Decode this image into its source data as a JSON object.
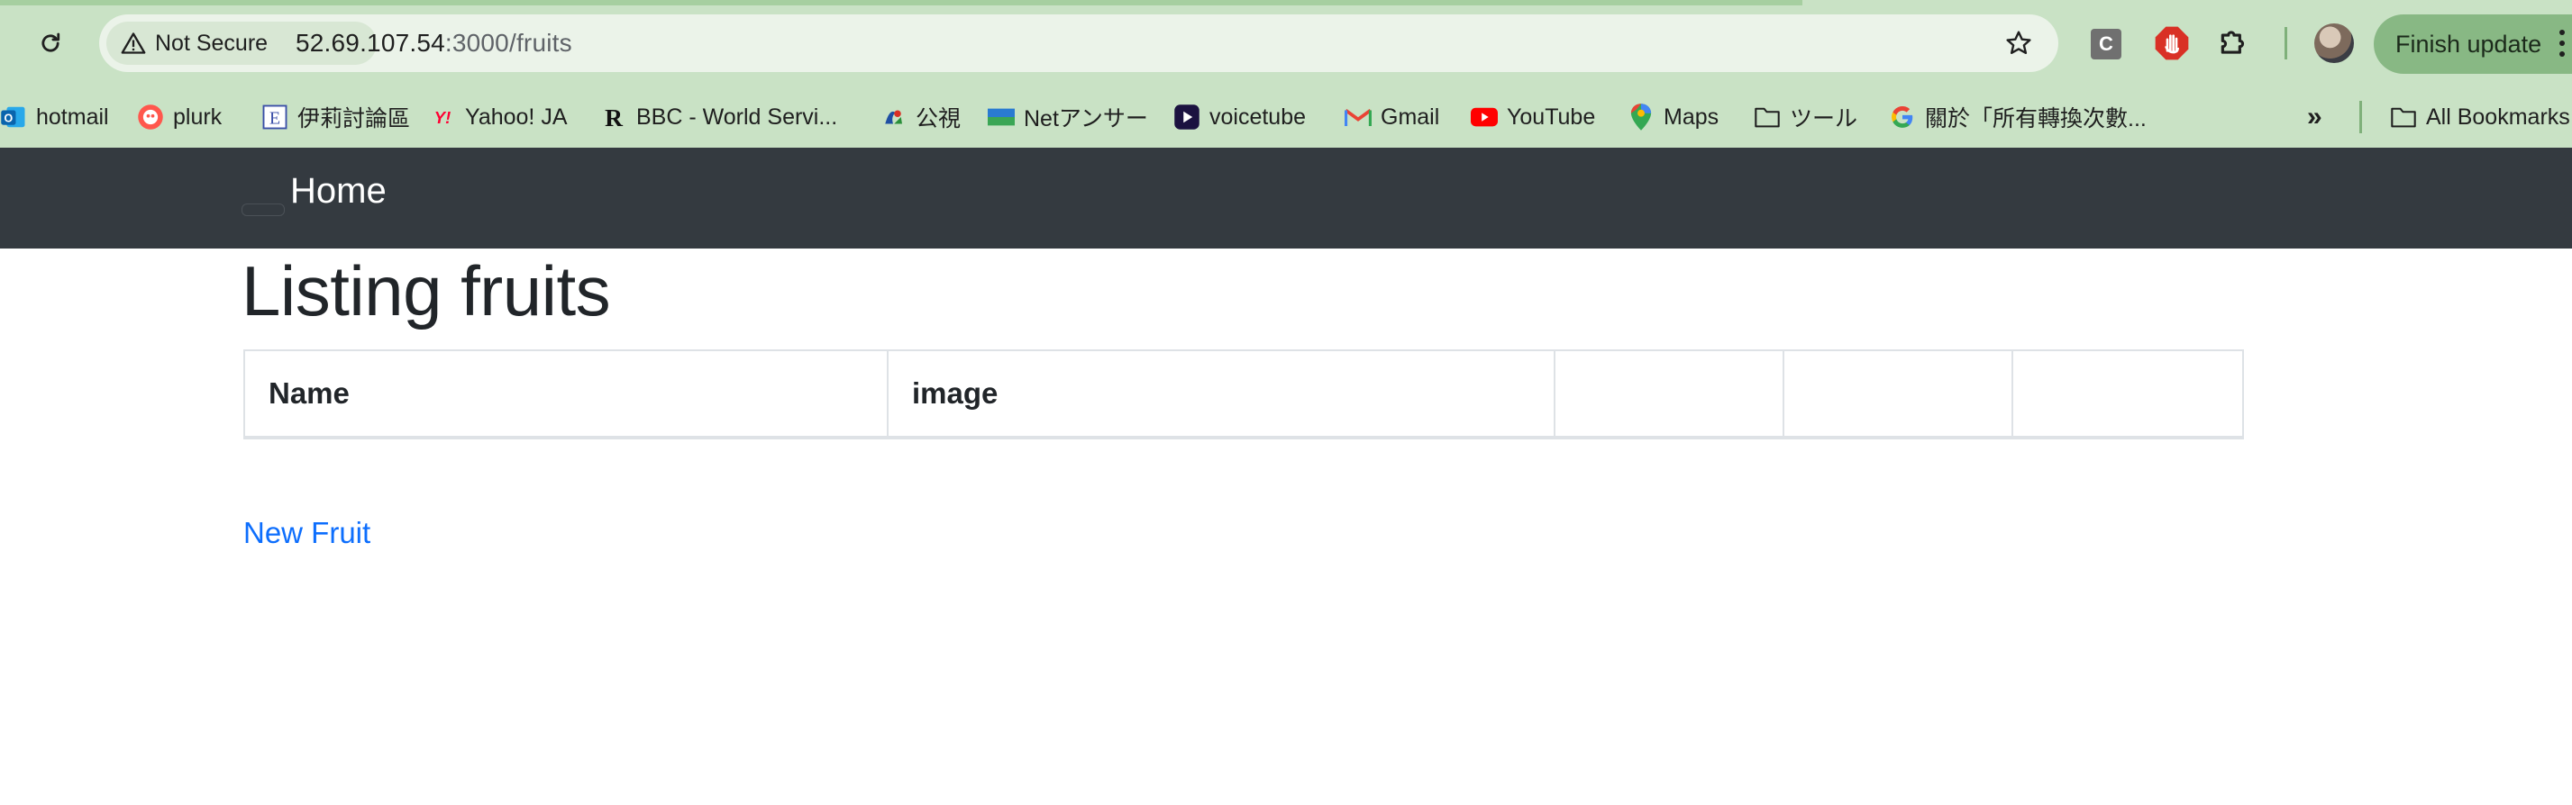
{
  "browser": {
    "security_label": "Not Secure",
    "url_host": "52.69.107.54",
    "url_path": ":3000/fruits",
    "finish_update_label": "Finish update",
    "extension_c_label": "C",
    "icons": [
      "reload-icon",
      "warning-icon",
      "star-icon",
      "stop-hand-icon",
      "puzzle-icon",
      "kebab-menu-icon"
    ],
    "accent_color": "#c9e2c5"
  },
  "bookmarks": {
    "items": [
      {
        "label": "hotmail",
        "icon": "outlook-icon"
      },
      {
        "label": "plurk",
        "icon": "plurk-icon"
      },
      {
        "label": "伊莉討論區",
        "icon": "eyny-icon"
      },
      {
        "label": "Yahoo! JA",
        "icon": "yahoo-icon"
      },
      {
        "label": "BBC - World Servi...",
        "icon": "bbc-r-icon"
      },
      {
        "label": "公視",
        "icon": "pts-icon"
      },
      {
        "label": "Netアンサー",
        "icon": "net-answer-icon"
      },
      {
        "label": "voicetube",
        "icon": "voicetube-icon"
      },
      {
        "label": "Gmail",
        "icon": "gmail-icon"
      },
      {
        "label": "YouTube",
        "icon": "youtube-icon"
      },
      {
        "label": "Maps",
        "icon": "maps-icon"
      },
      {
        "label": "ツール",
        "icon": "folder-icon"
      },
      {
        "label": "關於「所有轉換次數...",
        "icon": "google-icon"
      }
    ],
    "overflow_label": "»",
    "all_bookmarks_label": "All Bookmarks"
  },
  "navbar": {
    "brand": "Home",
    "background": "#343a40"
  },
  "main": {
    "title": "Listing fruits",
    "table": {
      "headers": [
        "Name",
        "image",
        "",
        "",
        ""
      ]
    },
    "new_link": "New Fruit",
    "link_color": "#0d6efd"
  }
}
